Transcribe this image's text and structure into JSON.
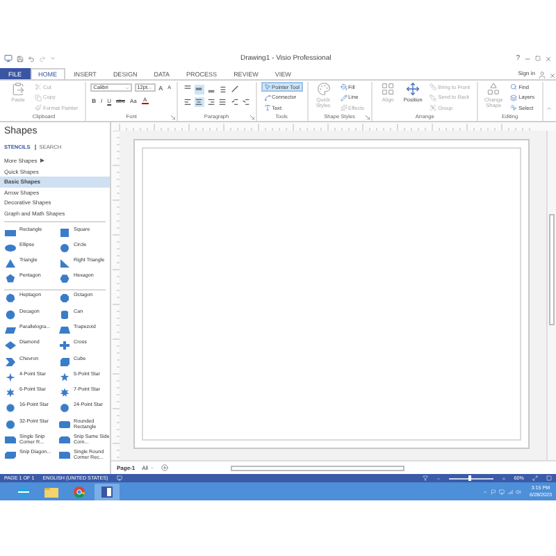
{
  "window": {
    "title": "Drawing1 - Visio Professional",
    "help": "?"
  },
  "tabs": [
    {
      "label": "FILE",
      "kind": "file",
      "selected": false
    },
    {
      "label": "HOME",
      "kind": "tab",
      "selected": true
    },
    {
      "label": "INSERT",
      "kind": "tab",
      "selected": false
    },
    {
      "label": "DESIGN",
      "kind": "tab",
      "selected": false
    },
    {
      "label": "DATA",
      "kind": "tab",
      "selected": false
    },
    {
      "label": "PROCESS",
      "kind": "tab",
      "selected": false
    },
    {
      "label": "REVIEW",
      "kind": "tab",
      "selected": false
    },
    {
      "label": "VIEW",
      "kind": "tab",
      "selected": false
    }
  ],
  "account": {
    "label": "Sign in"
  },
  "ribbon": [
    {
      "kind": "buttons",
      "label": "Clipboard",
      "launcher": false,
      "large": [
        {
          "label": "Paste",
          "disabled": true
        }
      ],
      "small": [
        {
          "label": "Cut",
          "disabled": true,
          "selected": false
        },
        {
          "label": "Copy",
          "disabled": true,
          "selected": false
        },
        {
          "label": "Format Painter",
          "disabled": true,
          "selected": false
        }
      ]
    },
    {
      "kind": "font",
      "label": "Font",
      "launcher": true,
      "font_name": "Calibri",
      "font_size": "12pt.",
      "size_buttons": [
        {
          "label": "A",
          "kind": "grow"
        },
        {
          "label": "A",
          "kind": "shrink"
        }
      ],
      "format_buttons": [
        {
          "label": "B",
          "kind": "bold"
        },
        {
          "label": "I",
          "kind": "italic"
        },
        {
          "label": "U",
          "kind": "underline"
        },
        {
          "label": "abc",
          "kind": "strike"
        },
        {
          "label": "Aa",
          "kind": "case"
        },
        {
          "label": "A",
          "kind": "color"
        }
      ]
    },
    {
      "kind": "paragraph",
      "label": "Paragraph",
      "launcher": true,
      "rows": [
        [
          {
            "selected": false
          },
          {
            "selected": true
          },
          {
            "selected": false
          },
          {
            "selected": false
          },
          {
            "selected": false
          }
        ],
        [
          {
            "selected": false
          },
          {
            "selected": true
          },
          {
            "selected": false
          },
          {
            "selected": false
          },
          {
            "selected": false
          },
          {
            "selected": false
          }
        ]
      ]
    },
    {
      "kind": "buttons",
      "label": "Tools",
      "launcher": false,
      "small": [
        {
          "label": "Pointer Tool",
          "disabled": false,
          "selected": true
        },
        {
          "label": "Connector",
          "disabled": false,
          "selected": false
        },
        {
          "label": "Text",
          "disabled": false,
          "selected": false
        }
      ]
    },
    {
      "kind": "buttons",
      "label": "Shape Styles",
      "launcher": true,
      "large": [
        {
          "label": "Quick Styles",
          "disabled": true
        }
      ],
      "small": [
        {
          "label": "Fill",
          "disabled": false,
          "selected": false
        },
        {
          "label": "Line",
          "disabled": false,
          "selected": false
        },
        {
          "label": "Effects",
          "disabled": true,
          "selected": false
        }
      ]
    },
    {
      "kind": "buttons",
      "label": "Arrange",
      "launcher": false,
      "large": [
        {
          "label": "Align",
          "disabled": true
        },
        {
          "label": "Position",
          "disabled": false
        }
      ],
      "small": [
        {
          "label": "Bring to Front",
          "disabled": true,
          "selected": false
        },
        {
          "label": "Send to Back",
          "disabled": true,
          "selected": false
        },
        {
          "label": "Group",
          "disabled": true,
          "selected": false
        }
      ]
    },
    {
      "kind": "buttons",
      "label": "Editing",
      "launcher": false,
      "large": [
        {
          "label": "Change Shape",
          "disabled": true
        }
      ],
      "small": [
        {
          "label": "Find",
          "disabled": false,
          "selected": false
        },
        {
          "label": "Layers",
          "disabled": false,
          "selected": false
        },
        {
          "label": "Select",
          "disabled": false,
          "selected": false
        }
      ]
    }
  ],
  "shapes_panel": {
    "title": "Shapes",
    "tabs": [
      {
        "label": "STENCILS",
        "selected": true
      },
      {
        "label": "SEARCH",
        "selected": false
      }
    ],
    "stencils": [
      {
        "label": "More Shapes",
        "kind": "menu",
        "selected": false
      },
      {
        "label": "Quick Shapes",
        "kind": "stencil",
        "selected": false
      },
      {
        "label": "Basic Shapes",
        "kind": "stencil",
        "selected": true
      },
      {
        "label": "Arrow Shapes",
        "kind": "stencil",
        "selected": false
      },
      {
        "label": "Decorative Shapes",
        "kind": "stencil",
        "selected": false
      },
      {
        "label": "Graph and Math Shapes",
        "kind": "stencil",
        "selected": false
      }
    ],
    "sections": [
      [
        "Rectangle",
        "Square",
        "Ellipse",
        "Circle",
        "Triangle",
        "Right Triangle",
        "Pentagon",
        "Hexagon"
      ],
      [
        "Heptagon",
        "Octagon",
        "Decagon",
        "Can",
        "Parallelogra...",
        "Trapezoid",
        "Diamond",
        "Cross",
        "Chevron",
        "Cube",
        "4-Point Star",
        "5-Point Star",
        "6-Point Star",
        "7-Point Star",
        "16-Point Star",
        "24-Point Star",
        "32-Point Star",
        "Rounded Rectangle",
        "Single Snip Corner R...",
        "Snip Same Side Corn...",
        "Snip Diagon...",
        "Single Round Corner Rec..."
      ]
    ]
  },
  "page_tabs": {
    "pages": [
      {
        "label": "Page-1",
        "selected": true
      }
    ],
    "all": "All"
  },
  "status_bar": {
    "page": "PAGE 1 OF 1",
    "language": "ENGLISH (UNITED STATES)",
    "zoom": "60%",
    "zoom_level": {
      "level": 0.45
    }
  },
  "taskbar": {
    "apps": [
      {
        "selected": false
      },
      {
        "selected": false
      },
      {
        "selected": false
      },
      {
        "selected": true
      }
    ],
    "time": "3:15 PM",
    "date": "6/28/2023"
  }
}
